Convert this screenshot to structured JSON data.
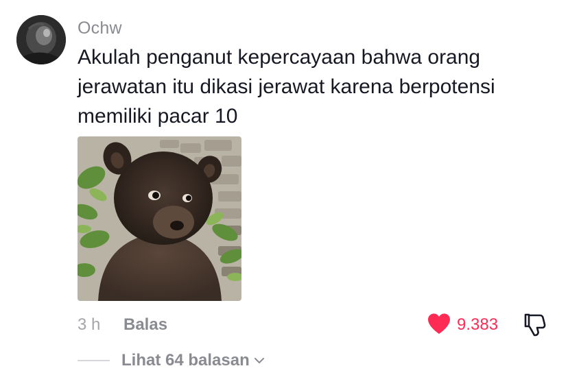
{
  "comment": {
    "username": "Ochw",
    "text_lines": [
      "Akulah penganut kepercayaan bahwa orang",
      "jerawatan itu dikasi jerawat karena berpotensi",
      "memiliki pacar 10"
    ],
    "timestamp": "3 h",
    "reply_label": "Balas",
    "like_count": "9.383",
    "view_replies_label": "Lihat 64 balasan"
  },
  "icons": {
    "like": "heart-icon",
    "dislike": "thumbs-down-icon",
    "expand": "chevron-down-icon"
  },
  "colors": {
    "like_accent": "#fe2c55",
    "muted_text": "#8a8b91",
    "body_text": "#161823"
  }
}
